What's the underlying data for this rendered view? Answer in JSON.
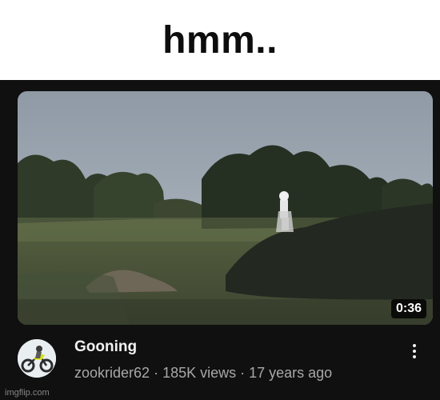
{
  "caption": {
    "text": "hmm.."
  },
  "video": {
    "duration": "0:36",
    "title": "Gooning",
    "channel": "zookrider62",
    "views": "185K views",
    "age": "17 years ago",
    "separator": " · ",
    "more_icon": "more-vert-icon",
    "avatar_icon": "dirt-bike-avatar"
  },
  "watermark": {
    "text": "imgflip.com"
  },
  "colors": {
    "caption_text": "#0d0d0d",
    "panel_bg": "#101010",
    "title_text": "#f1f1f1",
    "meta_text": "#a8a8a8"
  }
}
